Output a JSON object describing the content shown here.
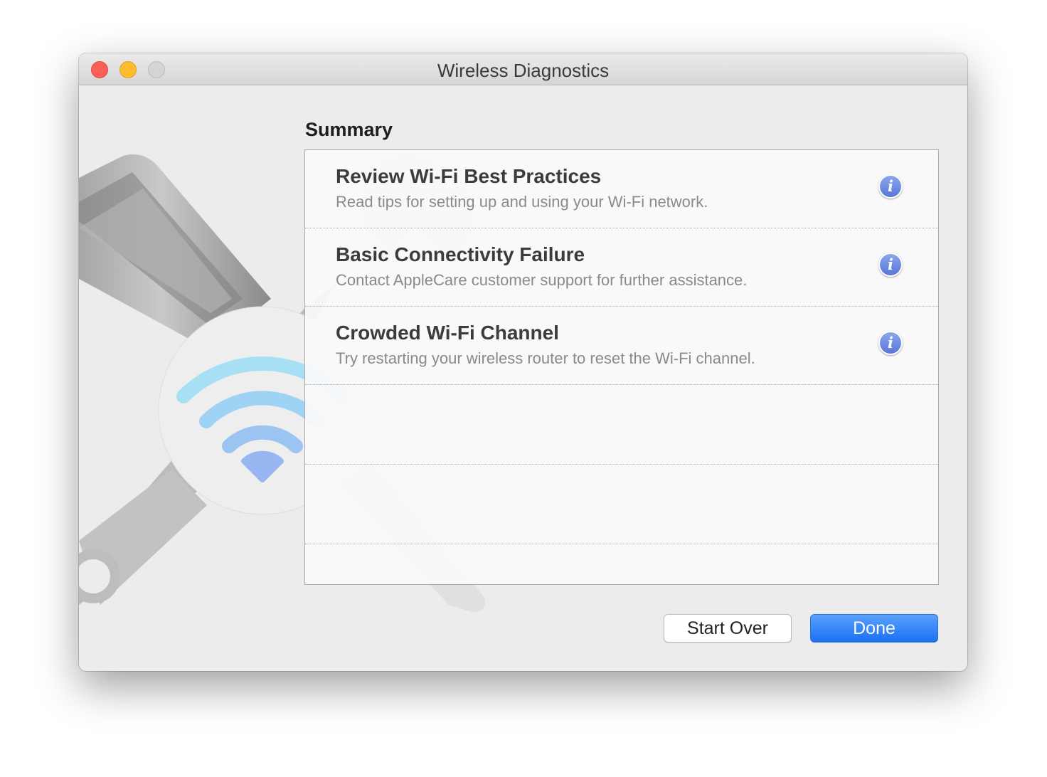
{
  "window": {
    "title": "Wireless Diagnostics"
  },
  "summary": {
    "heading": "Summary",
    "items": [
      {
        "title": "Review Wi-Fi Best Practices",
        "description": "Read tips for setting up and using your Wi-Fi network."
      },
      {
        "title": "Basic Connectivity Failure",
        "description": "Contact AppleCare customer support for further assistance."
      },
      {
        "title": "Crowded Wi-Fi Channel",
        "description": "Try restarting your wireless router to reset the Wi-Fi channel."
      }
    ]
  },
  "buttons": {
    "start_over": "Start Over",
    "done": "Done"
  },
  "icons": {
    "info": "i"
  },
  "colors": {
    "accent": "#1c71f2",
    "info_icon": "#6f8be2",
    "close": "#fc5f57",
    "minimize": "#fdbc2e",
    "zoom_disabled": "#d4d4d4"
  }
}
